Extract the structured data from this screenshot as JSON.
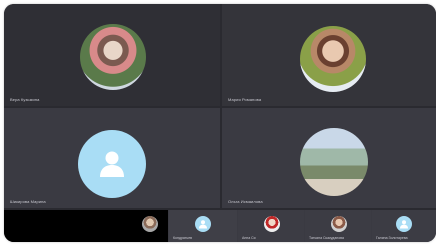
{
  "participants": [
    {
      "name": "Вера Кузьмина"
    },
    {
      "name": "Мария Романова"
    },
    {
      "name": "Шикирова Марина"
    },
    {
      "name": "Ольга Исмаилова"
    }
  ],
  "bottom_strip": [
    {
      "name": ""
    },
    {
      "name": "Кондратьев"
    },
    {
      "name": "Анна Ся"
    },
    {
      "name": "Татьяна Скакуданова"
    },
    {
      "name": "Галина Золотарева"
    }
  ],
  "colors": {
    "tile_bg": "#34343c",
    "avatar_placeholder": "#a9ddf5"
  }
}
